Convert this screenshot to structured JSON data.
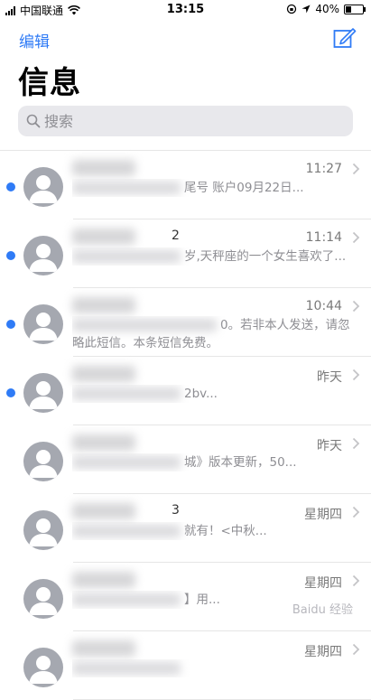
{
  "status_bar": {
    "carrier": "中国联通",
    "time": "13:15",
    "battery_text": "40%",
    "battery_level": 0.4
  },
  "nav": {
    "edit_label": "编辑",
    "title": "信息"
  },
  "search": {
    "placeholder": "搜索"
  },
  "messages": [
    {
      "unread": true,
      "sender_suffix": "",
      "time": "11:27",
      "preview": "尾号    账户09月22日...",
      "lines": 1
    },
    {
      "unread": true,
      "sender_suffix": "2",
      "time": "11:14",
      "preview": "岁,天秤座的一个女生喜欢了...",
      "lines": 1
    },
    {
      "unread": true,
      "sender_suffix": "",
      "time": "10:44",
      "preview": "0。若非本人发送，请忽略此短信。本条短信免费。",
      "lines": 2
    },
    {
      "unread": true,
      "sender_suffix": "",
      "time": "昨天",
      "preview": "2bv...",
      "lines": 1
    },
    {
      "unread": false,
      "sender_suffix": "",
      "time": "昨天",
      "preview": "城》版本更新，50...",
      "lines": 1
    },
    {
      "unread": false,
      "sender_suffix": "3",
      "time": "星期四",
      "preview": "就有！<中秋...",
      "lines": 1
    },
    {
      "unread": false,
      "sender_suffix": "",
      "time": "星期四",
      "preview": "】用...",
      "lines": 1
    },
    {
      "unread": false,
      "sender_suffix": "",
      "time": "星期四",
      "preview": "",
      "lines": 1
    }
  ],
  "watermark": "Baidu 经验",
  "colors": {
    "accent": "#2f7bf6",
    "unread_dot": "#2f7bf6",
    "avatar": "#a5a8b0"
  }
}
